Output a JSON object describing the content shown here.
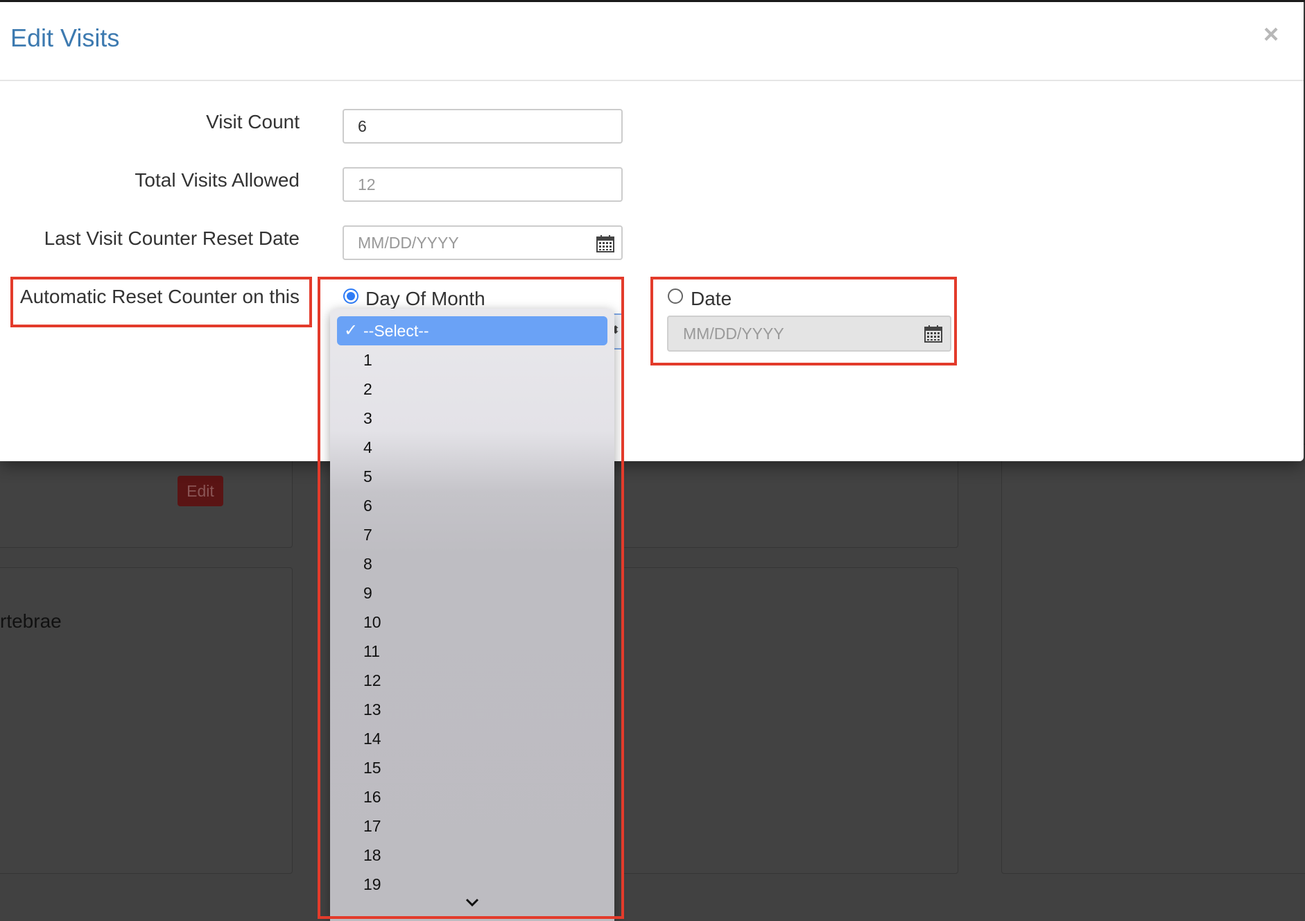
{
  "modal": {
    "title": "Edit Visits",
    "close_icon": "×"
  },
  "form": {
    "visit_count": {
      "label": "Visit Count",
      "value": "6"
    },
    "total_visits": {
      "label": "Total Visits Allowed",
      "placeholder": "12"
    },
    "last_reset_date": {
      "label": "Last Visit Counter Reset Date",
      "placeholder": "MM/DD/YYYY",
      "icon": "calendar-icon"
    },
    "auto_reset": {
      "label": "Automatic Reset Counter on this",
      "day_of_month": {
        "label": "Day Of Month",
        "checked": true
      },
      "date": {
        "label": "Date",
        "checked": false,
        "placeholder": "MM/DD/YYYY",
        "icon": "calendar-icon"
      }
    }
  },
  "dropdown": {
    "selected": "--Select--",
    "check": "✓",
    "options": [
      "1",
      "2",
      "3",
      "4",
      "5",
      "6",
      "7",
      "8",
      "9",
      "10",
      "11",
      "12",
      "13",
      "14",
      "15",
      "16",
      "17",
      "18",
      "19"
    ],
    "scroll_icon": "chevron-down-icon"
  },
  "background": {
    "edit_button": "Edit",
    "partial_text": "rtebrae"
  },
  "colors": {
    "title": "#3d7ab0",
    "highlight": "#e33b2b",
    "selected_option": "#6aa2f6",
    "overlay": "#414141"
  }
}
